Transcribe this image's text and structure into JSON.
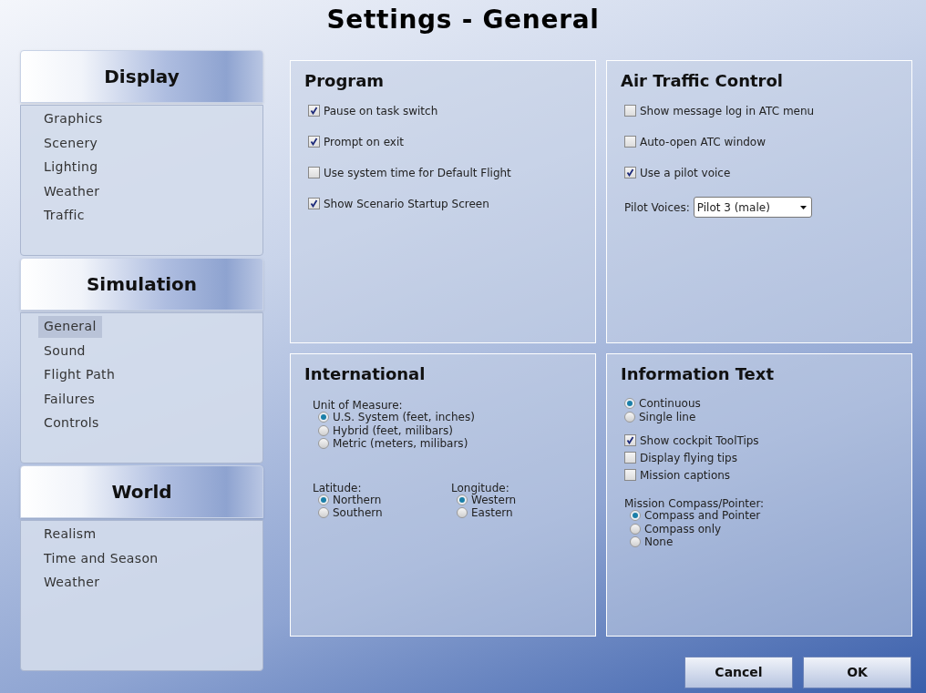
{
  "window": {
    "title": "Settings - General"
  },
  "sidebar": {
    "sections": [
      {
        "title": "Display",
        "items": [
          {
            "label": "Graphics",
            "selected": false
          },
          {
            "label": "Scenery",
            "selected": false
          },
          {
            "label": "Lighting",
            "selected": false
          },
          {
            "label": "Weather",
            "selected": false
          },
          {
            "label": "Traffic",
            "selected": false
          }
        ]
      },
      {
        "title": "Simulation",
        "items": [
          {
            "label": "General",
            "selected": true
          },
          {
            "label": "Sound",
            "selected": false
          },
          {
            "label": "Flight Path",
            "selected": false
          },
          {
            "label": "Failures",
            "selected": false
          },
          {
            "label": "Controls",
            "selected": false
          }
        ]
      },
      {
        "title": "World",
        "items": [
          {
            "label": "Realism",
            "selected": false
          },
          {
            "label": "Time and Season",
            "selected": false
          },
          {
            "label": "Weather",
            "selected": false
          }
        ]
      }
    ]
  },
  "panels": [
    {
      "title": "Program",
      "groups": [
        {
          "items": [
            {
              "kind": "checkbox",
              "label": "Pause on task switch",
              "checked": true
            }
          ]
        },
        {
          "items": [
            {
              "kind": "checkbox",
              "label": "Prompt on exit",
              "checked": true
            }
          ]
        },
        {
          "items": [
            {
              "kind": "checkbox",
              "label": "Use system time for Default Flight",
              "checked": false
            }
          ]
        },
        {
          "items": [
            {
              "kind": "checkbox",
              "label": "Show Scenario Startup Screen",
              "checked": true
            }
          ]
        }
      ]
    },
    {
      "title": "Air Traffic Control",
      "groups": [
        {
          "items": [
            {
              "kind": "checkbox",
              "label": "Show message log in ATC menu",
              "checked": false
            }
          ]
        },
        {
          "items": [
            {
              "kind": "checkbox",
              "label": "Auto-open ATC window",
              "checked": false
            }
          ]
        },
        {
          "items": [
            {
              "kind": "checkbox",
              "label": "Use a pilot voice",
              "checked": true
            }
          ]
        },
        {
          "items": [
            {
              "kind": "dropdown",
              "label": "Pilot Voices:",
              "value": "Pilot 3 (male)"
            }
          ]
        }
      ]
    },
    {
      "title": "International",
      "groups": [
        {
          "items": [
            {
              "kind": "heading",
              "label": "Unit of Measure:"
            },
            {
              "kind": "radio",
              "label": "U.S. System (feet, inches)",
              "selected": true
            },
            {
              "kind": "radio",
              "label": "Hybrid (feet, milibars)",
              "selected": false
            },
            {
              "kind": "radio",
              "label": "Metric (meters, milibars)",
              "selected": false
            }
          ]
        },
        {
          "columns": [
            {
              "items": [
                {
                  "kind": "heading",
                  "label": "Latitude:"
                },
                {
                  "kind": "radio",
                  "label": "Northern",
                  "selected": true
                },
                {
                  "kind": "radio",
                  "label": "Southern",
                  "selected": false
                }
              ]
            },
            {
              "items": [
                {
                  "kind": "heading",
                  "label": "Longitude:"
                },
                {
                  "kind": "radio",
                  "label": "Western",
                  "selected": true
                },
                {
                  "kind": "radio",
                  "label": "Eastern",
                  "selected": false
                }
              ]
            }
          ]
        }
      ]
    },
    {
      "title": "Information Text",
      "groups": [
        {
          "items": [
            {
              "kind": "radio",
              "label": "Continuous",
              "selected": true
            },
            {
              "kind": "radio",
              "label": "Single line",
              "selected": false
            }
          ]
        },
        {
          "items": [
            {
              "kind": "checkbox",
              "label": "Show cockpit ToolTips",
              "checked": true
            },
            {
              "kind": "checkbox",
              "label": "Display flying tips",
              "checked": false
            },
            {
              "kind": "checkbox",
              "label": "Mission captions",
              "checked": false
            }
          ]
        },
        {
          "items": [
            {
              "kind": "heading",
              "label": "Mission Compass/Pointer:"
            },
            {
              "kind": "radio",
              "label": "Compass and Pointer",
              "selected": true
            },
            {
              "kind": "radio",
              "label": "Compass only",
              "selected": false
            },
            {
              "kind": "radio",
              "label": "None",
              "selected": false
            }
          ]
        }
      ]
    }
  ],
  "buttons": [
    {
      "label": "Cancel"
    },
    {
      "label": "OK"
    }
  ]
}
